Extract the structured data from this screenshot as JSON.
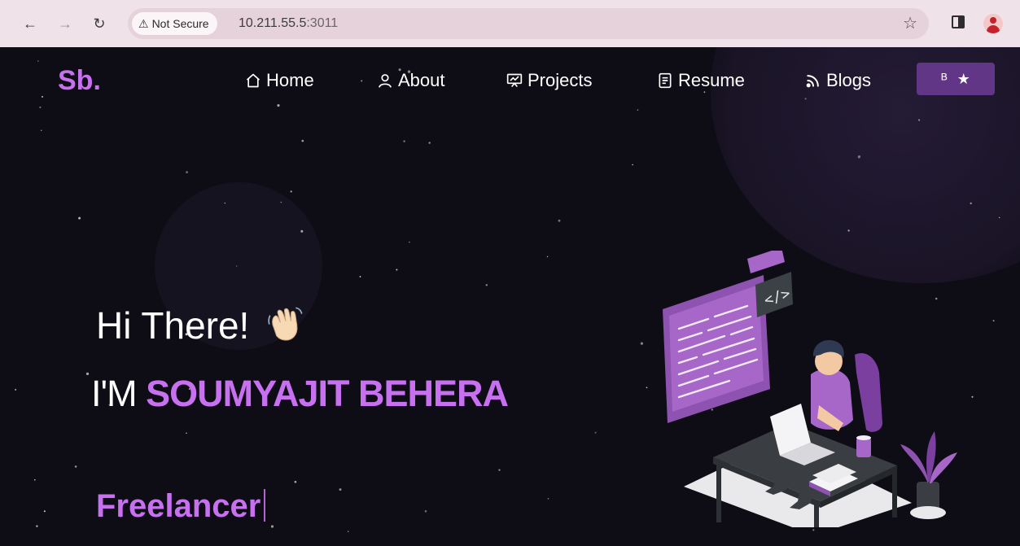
{
  "browser": {
    "security_label": "Not Secure",
    "url_host": "10.211.55.5",
    "url_port": ":3011"
  },
  "navbar": {
    "logo": "Sb.",
    "items": [
      {
        "label": "Home",
        "icon": "home-icon"
      },
      {
        "label": "About",
        "icon": "user-icon"
      },
      {
        "label": "Projects",
        "icon": "presentation-icon"
      },
      {
        "label": "Resume",
        "icon": "document-icon"
      },
      {
        "label": "Blogs",
        "icon": "rss-icon"
      }
    ],
    "fork_button": {
      "icons": [
        "git-fork-icon",
        "star-icon"
      ]
    }
  },
  "hero": {
    "greeting": "Hi There!",
    "intro_prefix": "I'M",
    "name": "SOUMYAJIT BEHERA",
    "typed_role": "Freelancer"
  },
  "colors": {
    "accent": "#c770f0",
    "background": "#0e0c15",
    "fork_button": "#623686"
  }
}
